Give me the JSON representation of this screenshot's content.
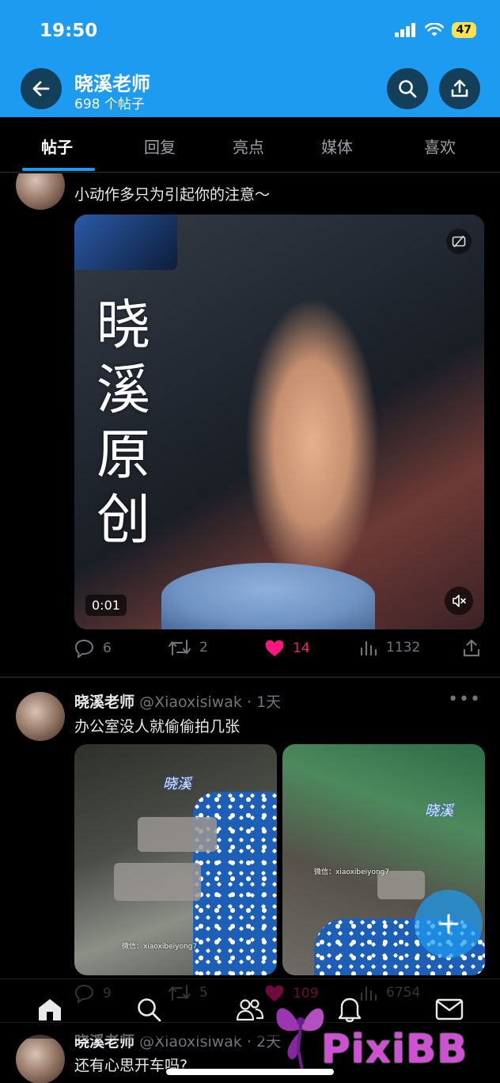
{
  "status": {
    "time": "19:50",
    "battery": "47"
  },
  "header": {
    "name": "晓溪老师",
    "post_count": "698 个帖子"
  },
  "tabs": [
    {
      "label": "帖子",
      "active": true
    },
    {
      "label": "回复",
      "active": false
    },
    {
      "label": "亮点",
      "active": false
    },
    {
      "label": "媒体",
      "active": false
    },
    {
      "label": "喜欢",
      "active": false
    }
  ],
  "tweets": [
    {
      "text": "小动作多只为引起你的注意～",
      "media": {
        "type": "video",
        "duration": "0:01",
        "watermark": "晓溪原创"
      },
      "stats": {
        "replies": "6",
        "retweets": "2",
        "likes": "14",
        "views": "1132"
      }
    },
    {
      "name": "晓溪老师",
      "handle": "@Xiaoxisiwak",
      "time": "· 1天",
      "text": "办公室没人就偷偷拍几张",
      "media": {
        "type": "photos",
        "watermark_cn": "晓溪",
        "watermark_id": "微信：xiaoxibeiyong7"
      },
      "stats": {
        "replies": "9",
        "retweets": "5",
        "likes": "109",
        "views": "6754"
      }
    },
    {
      "name": "晓溪老师",
      "handle": "@Xiaoxisiwak",
      "time": "· 2天",
      "text": "还有心思开车吗?"
    }
  ],
  "logo": {
    "text": "PixiBB"
  },
  "colors": {
    "accent": "#1d9bf0",
    "like": "#f91880",
    "muted": "#71767b"
  },
  "icons": [
    "back-icon",
    "search-icon",
    "share-icon",
    "reply-icon",
    "retweet-icon",
    "heart-icon",
    "views-icon",
    "home-icon",
    "people-icon",
    "bell-icon",
    "mail-icon",
    "plus-icon"
  ]
}
